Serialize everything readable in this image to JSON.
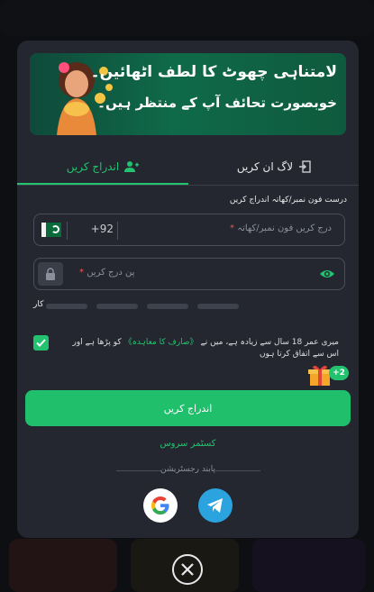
{
  "colors": {
    "accent": "#22c26e",
    "modal_bg": "#24272f",
    "banner_bg": "#0f6a49",
    "telegram": "#2aa3df"
  },
  "banner": {
    "line1": "لامتناہی چھوٹ کا لطف اٹھائیں۔",
    "line2": "خوبصورت تحائف آپ کے منتظر ہیں۔"
  },
  "tabs": [
    {
      "label": "اندراج کریں",
      "icon": "user-add-icon",
      "active": true
    },
    {
      "label": "لاگ ان کریں",
      "icon": "login-door-icon",
      "active": false
    }
  ],
  "form": {
    "hint": "درست فون نمبر/کھاتہ اندراج کریں",
    "phone": {
      "country_code": "+92",
      "placeholder": "درج کریں فون نمبر/کھاتہ",
      "value": "",
      "flag": "pakistan-flag-icon"
    },
    "password": {
      "placeholder": "پن درج کریں",
      "value": ""
    },
    "strength": {
      "label": "کار",
      "segments": 4,
      "filled": 0
    },
    "terms": {
      "checked": true,
      "text_before": "میری عمر 18 سال سے زیادہ ہے، میں نے",
      "link": "《صارف کا معاہدہ》",
      "text_after": "کو پڑھا ہے اور اس سے اتفاق کرتا ہوں"
    },
    "bonus_badge": "+2",
    "submit_label": "اندراج کریں",
    "support_label": "کسٹمر سروس",
    "ssl_label": "پابند رجسٹریشن"
  },
  "social": [
    {
      "name": "google",
      "icon": "google-icon"
    },
    {
      "name": "telegram",
      "icon": "telegram-icon"
    }
  ]
}
